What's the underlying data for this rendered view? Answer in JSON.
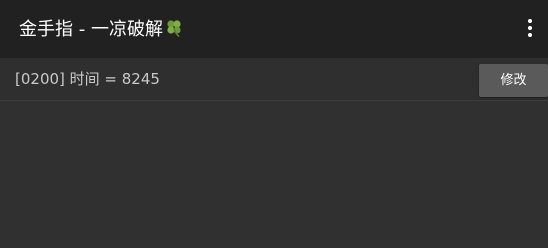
{
  "appbar": {
    "title": "金手指 - 一凉破解",
    "title_emoji_icon": "four-leaf-clover-icon",
    "menu_icon": "more-vertical-icon"
  },
  "list": {
    "items": [
      {
        "text": "[0200] 时间 = 8245",
        "button_label": "修改"
      }
    ]
  },
  "colors": {
    "appbar_bg": "#212121",
    "body_bg": "#303030",
    "button_bg": "#5a5a5a",
    "clover_green": "#6f9a3a"
  }
}
